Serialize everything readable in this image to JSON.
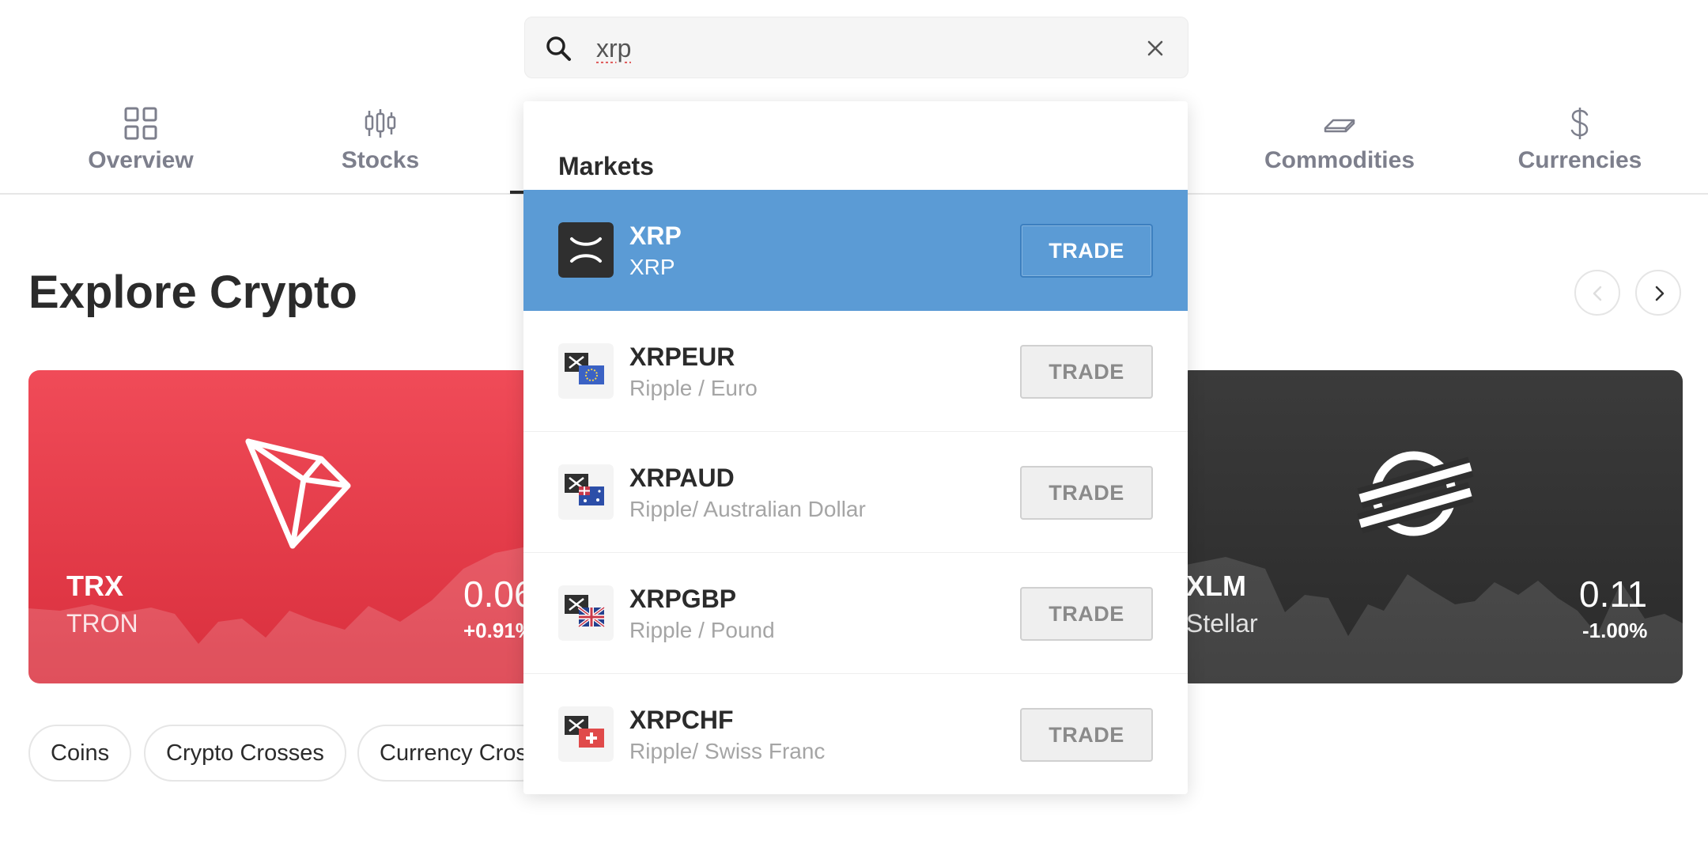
{
  "search": {
    "value": "xrp"
  },
  "nav": {
    "items": [
      {
        "label": "Overview",
        "icon": "overview-grid-icon"
      },
      {
        "label": "Stocks",
        "icon": "candlestick-icon"
      },
      {
        "label": "Commodities",
        "icon": "gold-bar-icon"
      },
      {
        "label": "Currencies",
        "icon": "dollar-icon"
      }
    ]
  },
  "explore": {
    "title": "Explore Crypto"
  },
  "cards": [
    {
      "symbol": "TRX",
      "name": "TRON",
      "price": "0.06",
      "change": "+0.91%",
      "color": "#e53c49"
    },
    {
      "symbol": "XLM",
      "name": "Stellar",
      "price": "0.11",
      "change": "-1.00%",
      "color": "#333333"
    }
  ],
  "chips": [
    "Coins",
    "Crypto Crosses",
    "Currency Cros"
  ],
  "dropdown": {
    "heading": "Markets",
    "items": [
      {
        "symbol": "XRP",
        "description": "XRP",
        "button": "TRADE",
        "active": true
      },
      {
        "symbol": "XRPEUR",
        "description": "Ripple / Euro",
        "button": "TRADE"
      },
      {
        "symbol": "XRPAUD",
        "description": "Ripple/ Australian Dollar",
        "button": "TRADE"
      },
      {
        "symbol": "XRPGBP",
        "description": "Ripple / Pound",
        "button": "TRADE"
      },
      {
        "symbol": "XRPCHF",
        "description": "Ripple/ Swiss Franc",
        "button": "TRADE"
      }
    ],
    "active_color": "#5b9bd5"
  }
}
